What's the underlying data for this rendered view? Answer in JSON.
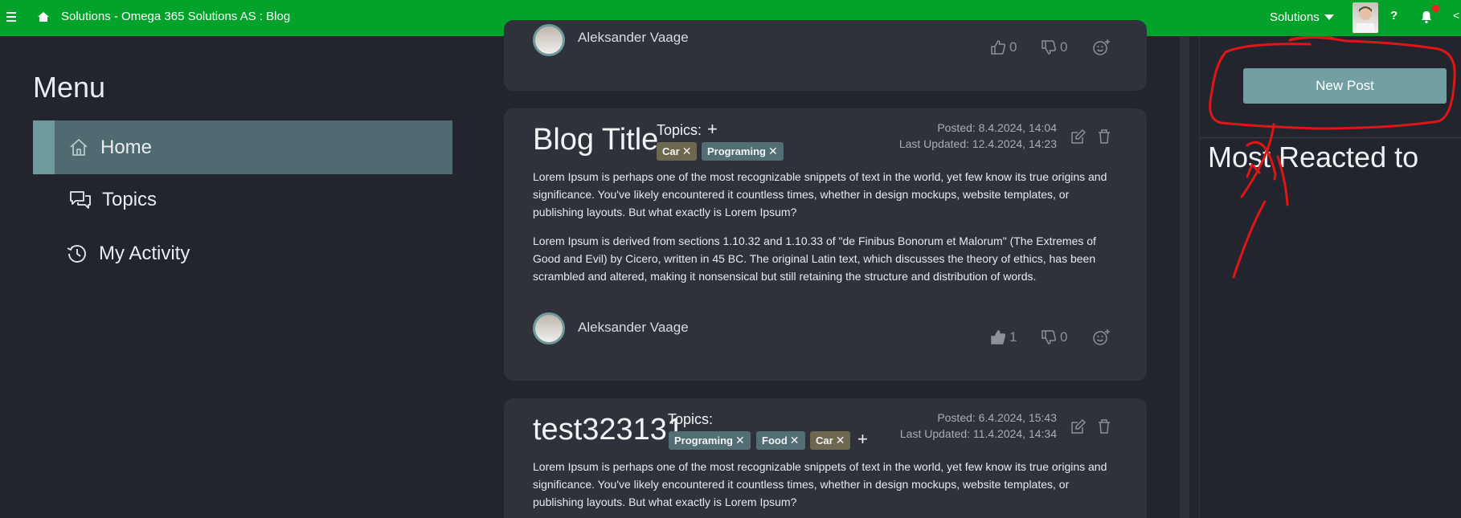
{
  "topbar": {
    "title": "Solutions - Omega 365 Solutions AS : Blog",
    "solutions_label": "Solutions",
    "help_label": "?",
    "collapse_label": "<"
  },
  "menu": {
    "title": "Menu",
    "items": [
      {
        "label": "Home",
        "icon": "home-icon",
        "active": true
      },
      {
        "label": "Topics",
        "icon": "chat-bubbles-icon",
        "active": false
      },
      {
        "label": "My Activity",
        "icon": "history-icon",
        "active": false
      }
    ]
  },
  "right_panel": {
    "new_post_label": "New Post",
    "most_reacted_title": "Most Reacted to"
  },
  "posts": [
    {
      "author": "Aleksander Vaage",
      "likes": "0",
      "dislikes": "0"
    },
    {
      "title": "Blog Title",
      "topics_label": "Topics:",
      "tags": [
        "Car",
        "Programing"
      ],
      "posted": "Posted: 8.4.2024, 14:04",
      "updated": "Last Updated: 12.4.2024, 14:23",
      "paragraphs": [
        "Lorem Ipsum is perhaps one of the most recognizable snippets of text in the world, yet few know its true origins and significance. You've likely encountered it countless times, whether in design mockups, website templates, or publishing layouts. But what exactly is Lorem Ipsum?",
        "Lorem Ipsum is derived from sections 1.10.32 and 1.10.33 of \"de Finibus Bonorum et Malorum\" (The Extremes of Good and Evil) by Cicero, written in 45 BC. The original Latin text, which discusses the theory of ethics, has been scrambled and altered, making it nonsensical but still retaining the structure and distribution of words."
      ],
      "author": "Aleksander Vaage",
      "likes": "1",
      "dislikes": "0"
    },
    {
      "title": "test323131",
      "topics_label": "Topics:",
      "tags": [
        "Programing",
        "Food",
        "Car"
      ],
      "posted": "Posted: 6.4.2024, 15:43",
      "updated": "Last Updated: 11.4.2024, 14:34",
      "paragraphs": [
        "Lorem Ipsum is perhaps one of the most recognizable snippets of text in the world, yet few know its true origins and significance. You've likely encountered it countless times, whether in design mockups, website templates, or publishing layouts. But what exactly is Lorem Ipsum?"
      ]
    }
  ],
  "colors": {
    "topbar": "#03a22a",
    "background": "#22252e",
    "card": "#2f323b",
    "accent": "#6f9a9c",
    "annotation": "#e01515"
  }
}
